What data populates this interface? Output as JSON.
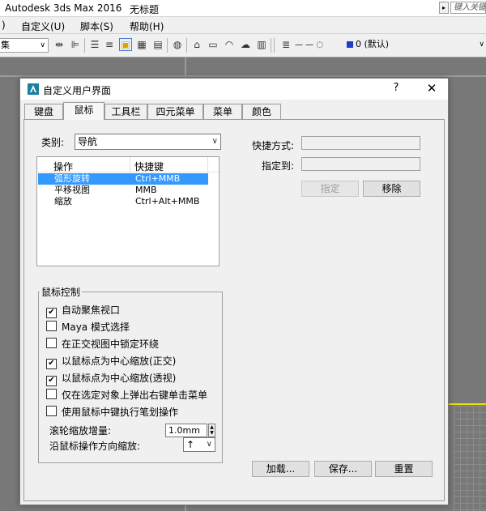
{
  "app": {
    "title": "Autodesk 3ds Max 2016",
    "doc_title": "无标题",
    "search_placeholder": "键入关键"
  },
  "menubar": {
    "items": [
      ")",
      "自定义(U)",
      "脚本(S)",
      "帮助(H)"
    ]
  },
  "toolbar": {
    "left_combo": "集",
    "layer_combo": "0 (默认)"
  },
  "dialog": {
    "title": "自定义用户界面",
    "help_label": "?",
    "close_label": "✕",
    "tabs": [
      "键盘",
      "鼠标",
      "工具栏",
      "四元菜单",
      "菜单",
      "颜色"
    ],
    "active_tab": "鼠标",
    "category_label": "类别:",
    "category_value": "导航",
    "list": {
      "columns": [
        "操作",
        "快捷键"
      ],
      "rows": [
        {
          "action": "弧形旋转",
          "shortcut": "Ctrl+MMB",
          "selected": true
        },
        {
          "action": "平移视图",
          "shortcut": "MMB",
          "selected": false
        },
        {
          "action": "缩放",
          "shortcut": "Ctrl+Alt+MMB",
          "selected": false
        }
      ]
    },
    "shortcut_label": "快捷方式:",
    "shortcut_value": "",
    "assigned_label": "指定到:",
    "assigned_value": "",
    "assign_button": "指定",
    "remove_button": "移除",
    "mouse_group_title": "鼠标控制",
    "checkboxes": [
      {
        "label": "自动聚焦视口",
        "checked": true
      },
      {
        "label": "Maya 模式选择",
        "checked": false
      },
      {
        "label": "在正交视图中锁定环绕",
        "checked": false
      },
      {
        "label": "以鼠标点为中心缩放(正交)",
        "checked": true
      },
      {
        "label": "以鼠标点为中心缩放(透视)",
        "checked": true
      },
      {
        "label": "仅在选定对象上弹出右键单击菜单",
        "checked": false
      },
      {
        "label": "使用鼠标中键执行笔划操作",
        "checked": false
      }
    ],
    "wheel_zoom_label": "滚轮缩放增量:",
    "wheel_zoom_value": "1.0mm",
    "zoom_direction_label": "沿鼠标操作方向缩放:",
    "zoom_direction_value": "↑",
    "load_button": "加载...",
    "save_button": "保存...",
    "reset_button": "重置"
  }
}
